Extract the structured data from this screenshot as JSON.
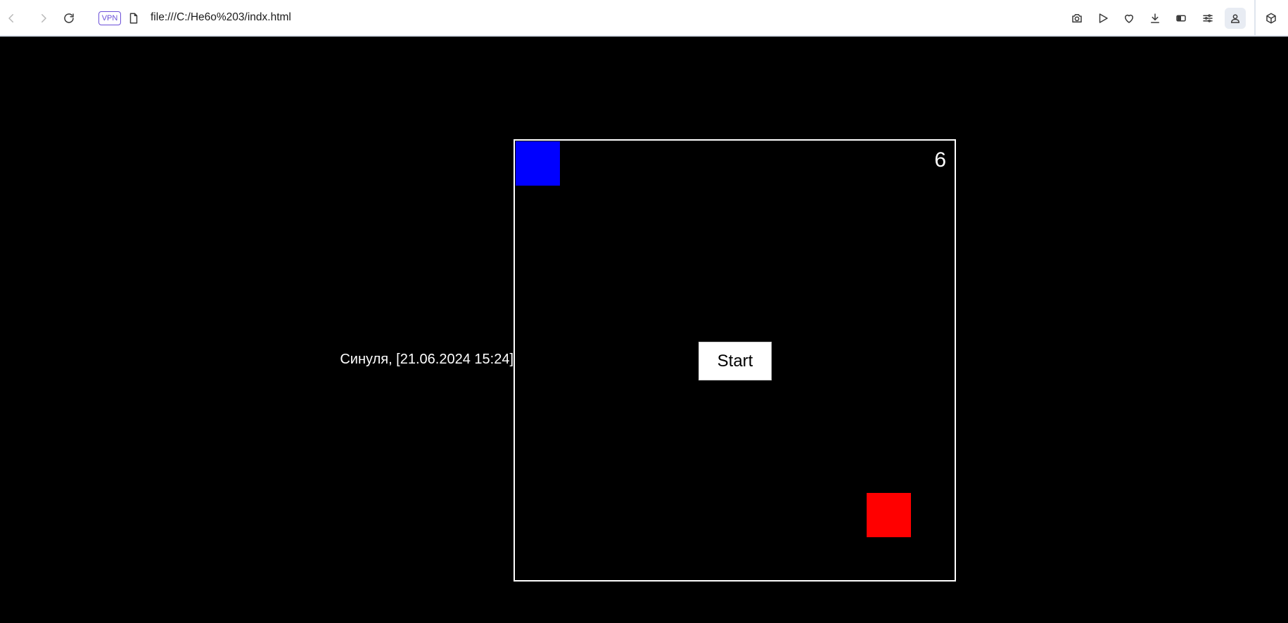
{
  "browser": {
    "url": "file:///C:/Не6о%203/indx.html",
    "vpn_label": "VPN",
    "toolbar_icons": [
      "back-icon",
      "forward-icon",
      "reload-icon",
      "file-icon",
      "camera-icon",
      "send-icon",
      "heart-icon",
      "download-icon",
      "battery-icon",
      "settings-sliders-icon",
      "profile-icon",
      "cube-icon"
    ]
  },
  "game": {
    "score": "6",
    "start_label": "Start",
    "player_color": "#0000ff",
    "enemy_color": "#ff0000",
    "border_color": "#ffffff",
    "background_color": "#000000"
  },
  "chat": {
    "text": "Синуля, [21.06.2024 15:24]"
  }
}
